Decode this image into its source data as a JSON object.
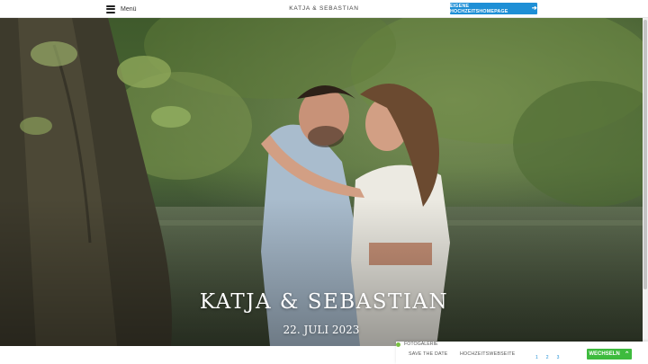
{
  "header": {
    "menu_label": "Menü",
    "site_title": "KATJA & SEBASTIAN",
    "cta_label": "EIGENE HOCHZEITSHOMEPAGE",
    "cta_icon": "arrow-right-icon",
    "cta_color": "#1e8fd6"
  },
  "hero": {
    "title": "KATJA & SEBASTIAN",
    "date": "22. JULI 2023",
    "image_subject": "couple embracing by a lake under trees"
  },
  "bottom_nav": {
    "items": [
      {
        "label": "SAVE THE DATE"
      },
      {
        "label": "HOCHZEITSWEBSEITE"
      }
    ],
    "gallery": {
      "label": "FOTOGALERIE",
      "status_color": "#7ac143",
      "pages": [
        "1",
        "2",
        "3"
      ]
    },
    "switch_label": "WECHSELN",
    "switch_icon": "chevron-up-icon",
    "switch_color": "#3ebb3e"
  }
}
